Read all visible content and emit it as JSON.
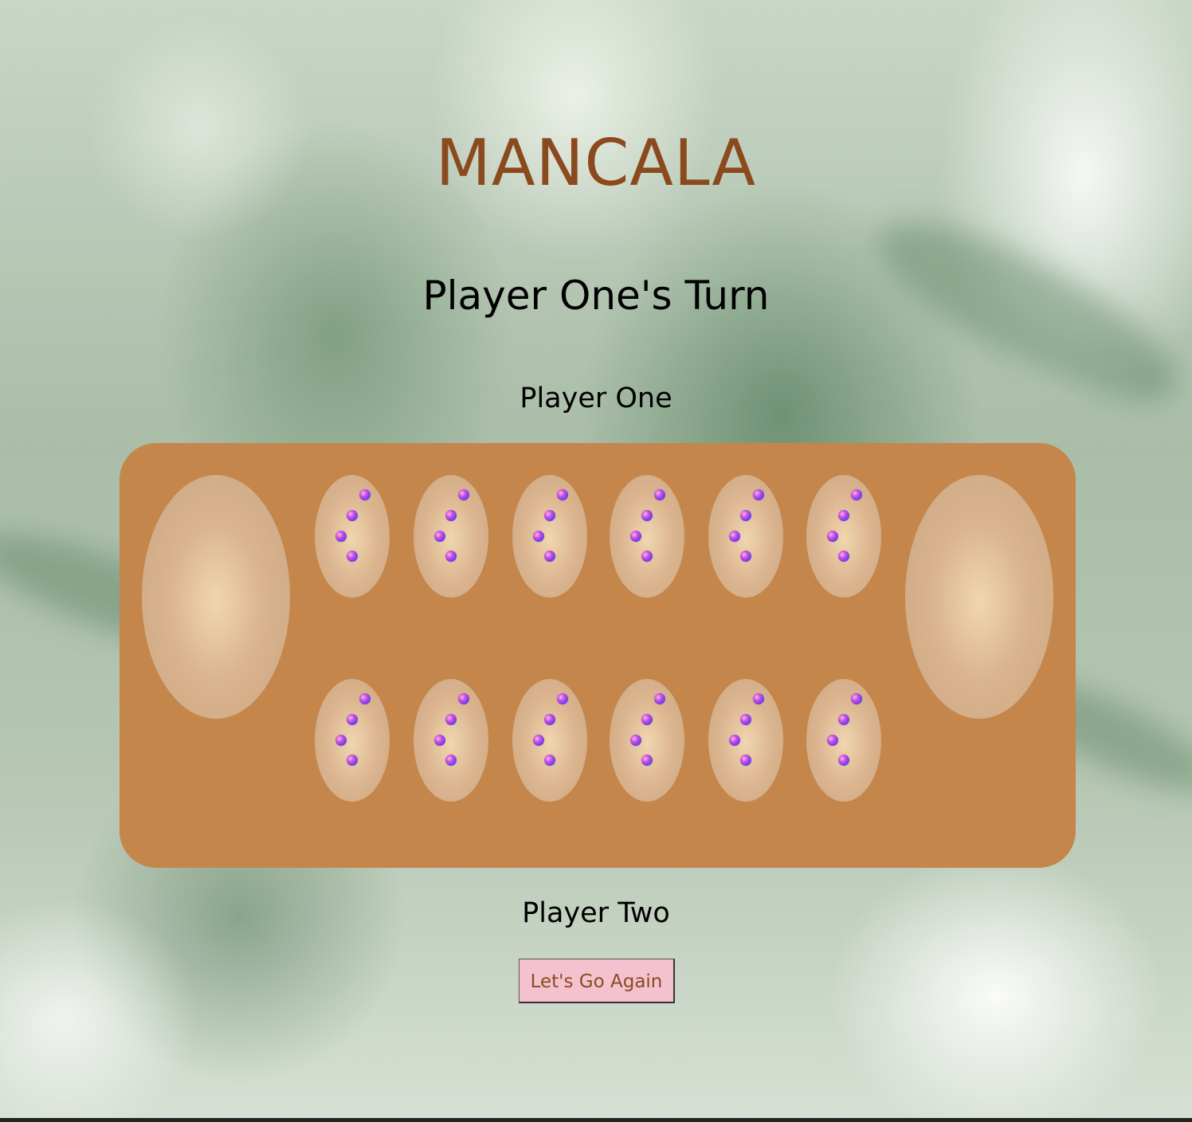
{
  "title": "MANCALA",
  "turn_status": "Player One's Turn",
  "player_one_label": "Player One",
  "player_two_label": "Player Two",
  "restart_label": "Let's Go Again",
  "colors": {
    "title": "#8b4a1e",
    "board": "#c4864a",
    "button": "#f4c2cf"
  },
  "board": {
    "top_pits": [
      4,
      4,
      4,
      4,
      4,
      4
    ],
    "bottom_pits": [
      4,
      4,
      4,
      4,
      4,
      4
    ],
    "left_store": 0,
    "right_store": 0
  }
}
